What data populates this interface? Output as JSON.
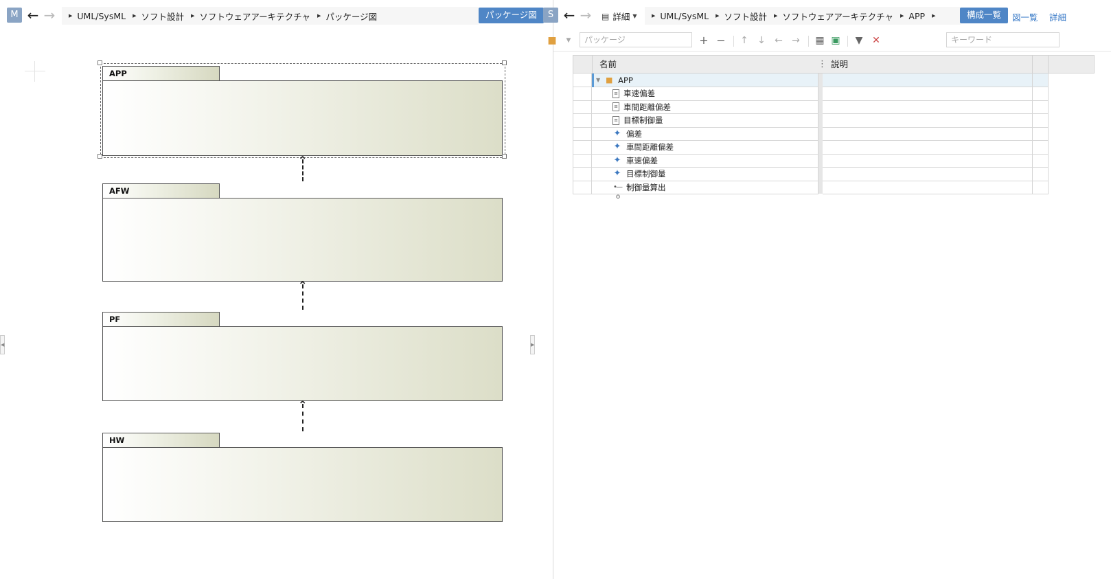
{
  "left_pane": {
    "badge": "M",
    "breadcrumb": [
      "UML/SysML",
      "ソフト設計",
      "ソフトウェアアーキテクチャ",
      "パッケージ図"
    ],
    "view_button": "パッケージ図",
    "packages": [
      "APP",
      "AFW",
      "PF",
      "HW"
    ],
    "selected_package": "APP"
  },
  "right_pane": {
    "badge": "S",
    "view_mode": "詳細",
    "breadcrumb": [
      "UML/SysML",
      "ソフト設計",
      "ソフトウェアアーキテクチャ",
      "APP"
    ],
    "buttons": {
      "structure_list": "構成一覧",
      "diagram_list": "図一覧",
      "detail": "詳細"
    },
    "toolbar": {
      "type_placeholder": "パッケージ",
      "keyword_placeholder": "キーワード"
    },
    "grid": {
      "columns": {
        "name": "名前",
        "description": "説明"
      },
      "rows": [
        {
          "name": "APP",
          "icon": "folder-icon",
          "level": 0,
          "description": ""
        },
        {
          "name": "車速偏差",
          "icon": "component-icon",
          "level": 1,
          "description": ""
        },
        {
          "name": "車間距離偏差",
          "icon": "component-icon",
          "level": 1,
          "description": ""
        },
        {
          "name": "目標制御量",
          "icon": "component-icon",
          "level": 1,
          "description": ""
        },
        {
          "name": "偏差",
          "icon": "function-icon",
          "level": 1,
          "description": ""
        },
        {
          "name": "車間距離偏差",
          "icon": "function-icon",
          "level": 1,
          "description": ""
        },
        {
          "name": "車速偏差",
          "icon": "function-icon",
          "level": 1,
          "description": ""
        },
        {
          "name": "目標制御量",
          "icon": "function-icon",
          "level": 1,
          "description": ""
        },
        {
          "name": "制御量算出",
          "icon": "port-icon",
          "level": 1,
          "description": ""
        }
      ]
    }
  },
  "colors": {
    "accent": "#4f86c6",
    "link": "#3a7bc8",
    "folder": "#e0a040",
    "function_icon": "#3c78c0"
  }
}
